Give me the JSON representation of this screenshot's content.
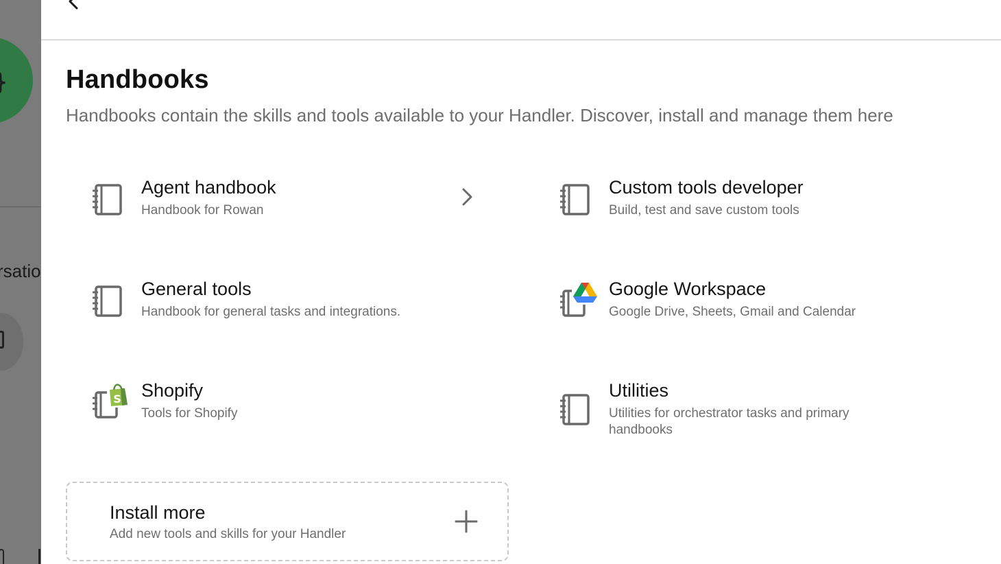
{
  "background": {
    "partial_text": "rsatio"
  },
  "drawer": {
    "back_icon": "chevron-left-icon"
  },
  "page": {
    "title": "Handbooks",
    "subtitle": "Handbooks contain the skills and tools available to your Handler. Discover, install and manage them here"
  },
  "handbooks": [
    {
      "title": "Agent handbook",
      "description": "Handbook for Rowan",
      "icon": "notebook-icon",
      "has_chevron": true
    },
    {
      "title": "Custom tools developer",
      "description": "Build, test and save custom tools",
      "icon": "notebook-icon"
    },
    {
      "title": "General tools",
      "description": "Handbook for general tasks and integrations.",
      "icon": "notebook-icon"
    },
    {
      "title": "Google Workspace",
      "description": "Google Drive, Sheets, Gmail and Calendar",
      "icon": "notebook-google-drive-icon"
    },
    {
      "title": "Shopify",
      "description": "Tools for Shopify",
      "icon": "notebook-shopify-icon"
    },
    {
      "title": "Utilities",
      "description": "Utilities for orchestrator tasks and primary handbooks",
      "icon": "notebook-icon"
    }
  ],
  "install_more": {
    "title": "Install more",
    "description": "Add new tools and skills for your Handler",
    "icon": "plus-icon"
  },
  "colors": {
    "avatar_green": "#2f7a45",
    "shopify_green": "#95bf47",
    "drive_green": "#0f9d58",
    "drive_yellow": "#f4b400",
    "drive_blue": "#4285f4",
    "drive_red": "#db4437"
  }
}
